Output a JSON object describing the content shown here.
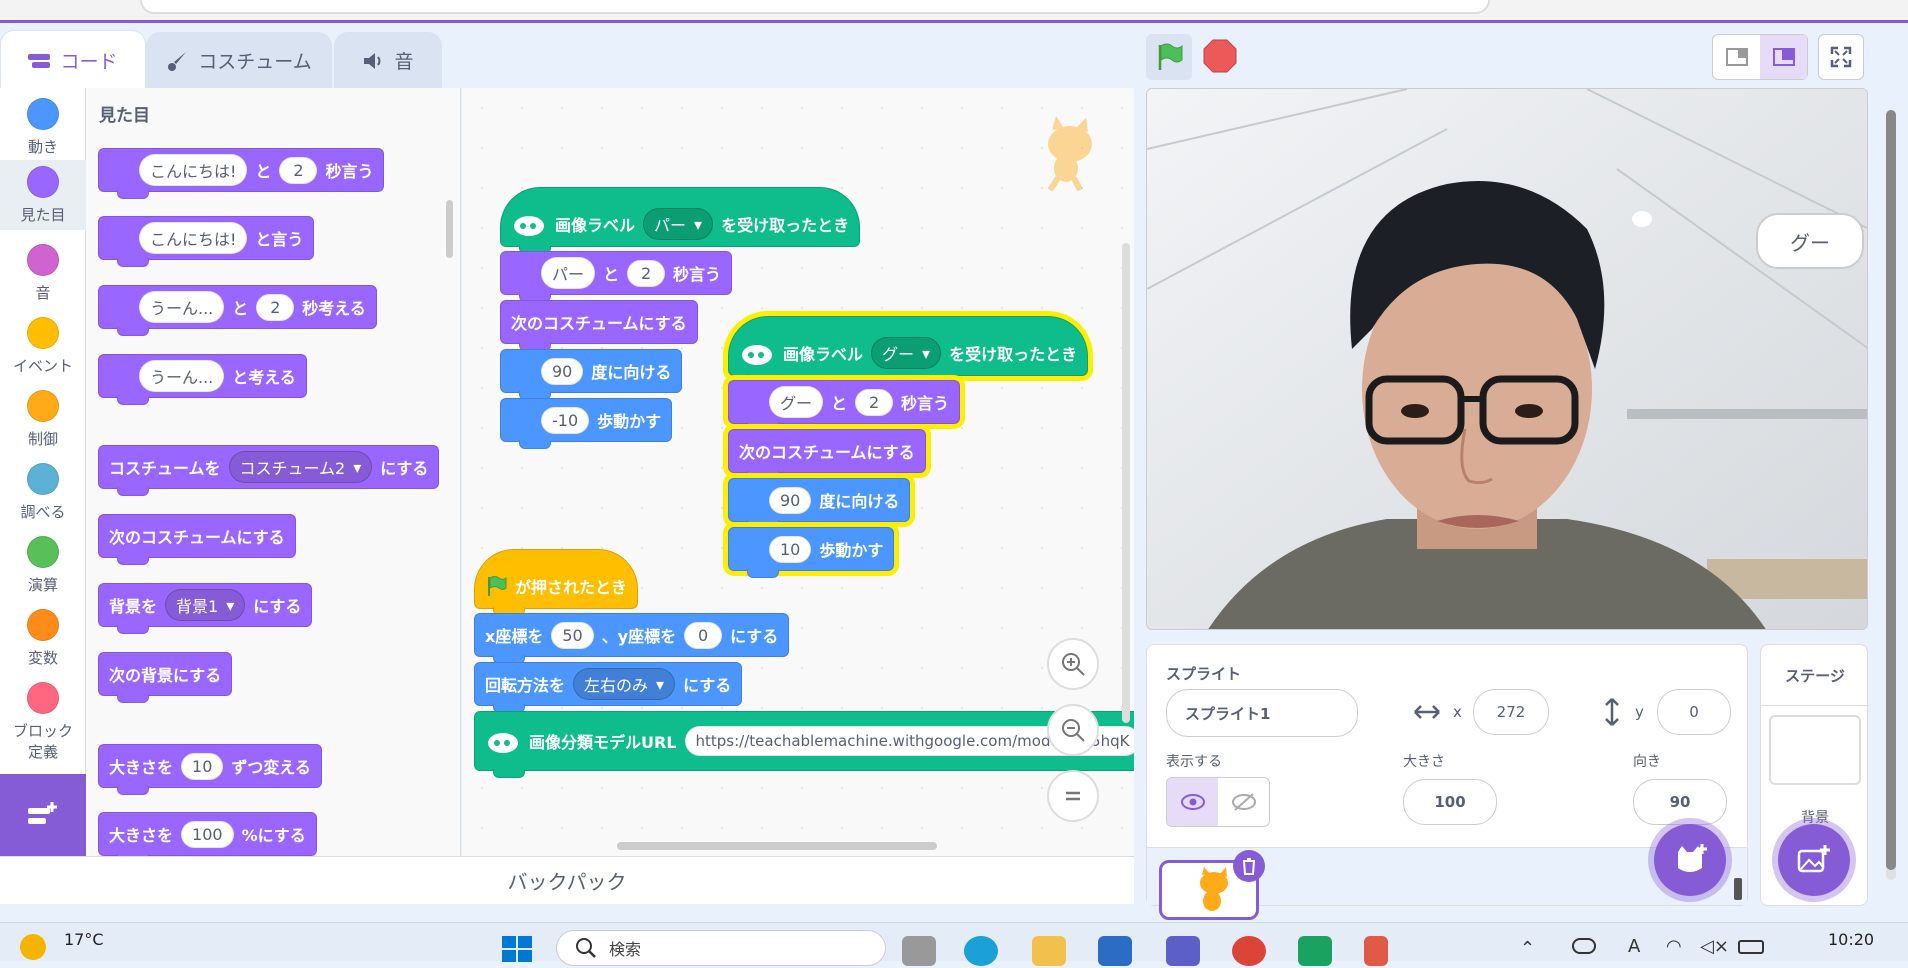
{
  "tabs": {
    "code": "コード",
    "costume": "コスチューム",
    "sound": "音"
  },
  "categories": [
    {
      "label": "動き",
      "color": "#4c97ff"
    },
    {
      "label": "見た目",
      "color": "#9966ff"
    },
    {
      "label": "音",
      "color": "#cf63cf"
    },
    {
      "label": "イベント",
      "color": "#ffbf00"
    },
    {
      "label": "制御",
      "color": "#ffab19"
    },
    {
      "label": "調べる",
      "color": "#5cb1d6"
    },
    {
      "label": "演算",
      "color": "#59c059"
    },
    {
      "label": "変数",
      "color": "#ff8c1a"
    },
    {
      "label": "ブロック定義",
      "color": "#ff6680"
    }
  ],
  "palette": {
    "heading": "見た目",
    "say_secs": {
      "msg": "こんにちは!",
      "to": "と",
      "secs": "2",
      "tail": "秒言う"
    },
    "say": {
      "msg": "こんにちは!",
      "tail": "と言う"
    },
    "think_secs": {
      "msg": "うーん...",
      "to": "と",
      "secs": "2",
      "tail": "秒考える"
    },
    "think": {
      "msg": "うーん...",
      "tail": "と考える"
    },
    "switch_costume": {
      "head": "コスチュームを",
      "value": "コスチューム2",
      "tail": "にする"
    },
    "next_costume": "次のコスチュームにする",
    "switch_backdrop": {
      "head": "背景を",
      "value": "背景1",
      "tail": "にする"
    },
    "next_backdrop": "次の背景にする",
    "change_size": {
      "head": "大きさを",
      "value": "10",
      "tail": "ずつ変える"
    },
    "set_size": {
      "head": "大きさを",
      "value": "100",
      "tail": "%にする"
    }
  },
  "script1": {
    "hat": {
      "head": "画像ラベル",
      "value": "パー",
      "tail": "を受け取ったとき"
    },
    "say": {
      "msg": "パー",
      "to": "と",
      "secs": "2",
      "tail": "秒言う"
    },
    "next_costume": "次のコスチュームにする",
    "point": {
      "value": "90",
      "tail": "度に向ける"
    },
    "move": {
      "value": "-10",
      "tail": "歩動かす"
    }
  },
  "script2": {
    "hat": {
      "head": "画像ラベル",
      "value": "グー",
      "tail": "を受け取ったとき"
    },
    "say": {
      "msg": "グー",
      "to": "と",
      "secs": "2",
      "tail": "秒言う"
    },
    "next_costume": "次のコスチュームにする",
    "point": {
      "value": "90",
      "tail": "度に向ける"
    },
    "move": {
      "value": "10",
      "tail": "歩動かす"
    }
  },
  "script3": {
    "hat": "が押されたとき",
    "goto": {
      "x_label": "x座標を",
      "x": "50",
      "y_label": "、y座標を",
      "y": "0",
      "tail": "にする"
    },
    "rotation": {
      "head": "回転方法を",
      "value": "左右のみ",
      "tail": "にする"
    },
    "model": {
      "head": "画像分類モデルURL",
      "url": "https://teachablemachine.withgoogle.com/models/...5hqK"
    }
  },
  "backpack": "バックパック",
  "stage": {
    "bubble": "グー"
  },
  "sprite_info": {
    "sprite_label": "スプライト",
    "sprite_name": "スプライト1",
    "x_label": "x",
    "x": "272",
    "y_label": "y",
    "y": "0",
    "show_label": "表示する",
    "size_label": "大きさ",
    "size": "100",
    "direction_label": "向き",
    "direction": "90"
  },
  "stage_panel": {
    "title": "ステージ",
    "backdrops_label": "背景"
  },
  "taskbar": {
    "temp": "17°C",
    "search": "検索",
    "time": "10:20"
  }
}
